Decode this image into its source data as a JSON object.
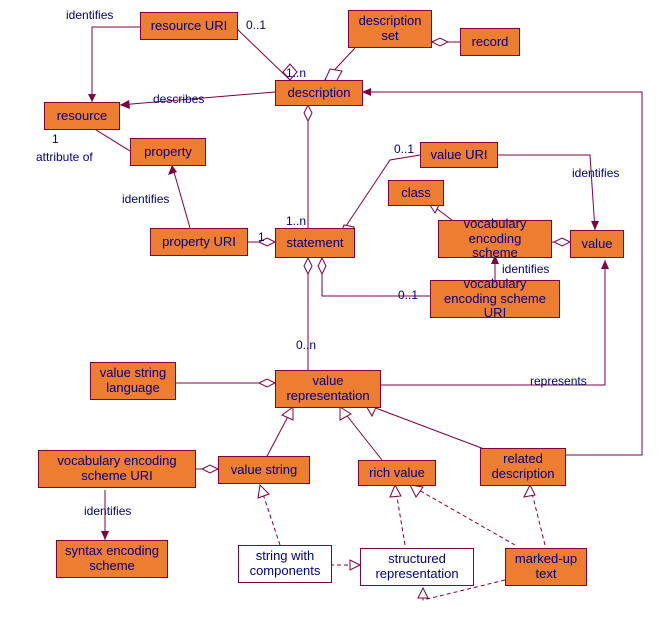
{
  "boxes": {
    "resource_uri": "resource URI",
    "description_set": "description set",
    "record": "record",
    "resource": "resource",
    "description": "description",
    "property": "property",
    "value_uri": "value URI",
    "class": "class",
    "property_uri": "property URI",
    "statement": "statement",
    "vocab_enc_scheme": "vocabulary encoding scheme",
    "value": "value",
    "vocab_enc_scheme_uri": "vocabulary encoding scheme URI",
    "value_string_language": "value string language",
    "value_representation": "value representation",
    "vocab_enc_scheme_uri2": "vocabulary encoding scheme URI",
    "value_string": "value string",
    "rich_value": "rich value",
    "related_description": "related description",
    "syntax_encoding_scheme": "syntax encoding scheme",
    "string_with_components": "string with components",
    "structured_representation": "structured representation",
    "marked_up_text": "marked-up text"
  },
  "labels": {
    "identifies1": "identifies",
    "m01_1": "0..1",
    "describes": "describes",
    "one1": "1",
    "attribute_of": "attribute of",
    "identifies2": "identifies",
    "m1n_desc": "1..n",
    "m01_valueuri": "0..1",
    "identifies3": "identifies",
    "m1n_stmt": "1..n",
    "one_prop": "1",
    "identifies4": "identifies",
    "m01_ves": "0..1",
    "m0n_valrep": "0..n",
    "represents": "represents",
    "identifies5": "identifies"
  }
}
